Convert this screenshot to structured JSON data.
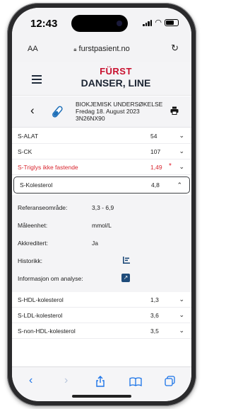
{
  "status": {
    "time": "12:43"
  },
  "browser": {
    "aa_label": "AA",
    "url": "furstpasient.no"
  },
  "app": {
    "logo": "FÜRST",
    "patient_name": "DANSER, LINE"
  },
  "order": {
    "title": "BIOKJEMISK UNDERSØKELSE",
    "date": "Fredag 18. August 2023",
    "id": "3N26NX90"
  },
  "rows_top": [
    {
      "name": "S-ALAT",
      "value": "54",
      "abnormal": false
    },
    {
      "name": "S-CK",
      "value": "107",
      "abnormal": false
    },
    {
      "name": "S-Triglys ikke fastende",
      "value": "1,49",
      "abnormal": true,
      "flag": "*"
    }
  ],
  "expanded_row": {
    "name": "S-Kolesterol",
    "value": "4,8"
  },
  "details": {
    "reference_label": "Referanseområde:",
    "reference_value": "3,3 - 6,9",
    "unit_label": "Måleenhet:",
    "unit_value": "mmol/L",
    "accredited_label": "Akkreditert:",
    "accredited_value": "Ja",
    "history_label": "Historikk:",
    "info_label": "Informasjon om analyse:"
  },
  "rows_bottom": [
    {
      "name": "S-HDL-kolesterol",
      "value": "1,3"
    },
    {
      "name": "S-LDL-kolesterol",
      "value": "3,6"
    },
    {
      "name": "S-non-HDL-kolesterol",
      "value": "3,5"
    }
  ],
  "colors": {
    "brand_red": "#c8102e",
    "abnormal": "#d8262f",
    "ios_blue": "#1a73e8"
  }
}
